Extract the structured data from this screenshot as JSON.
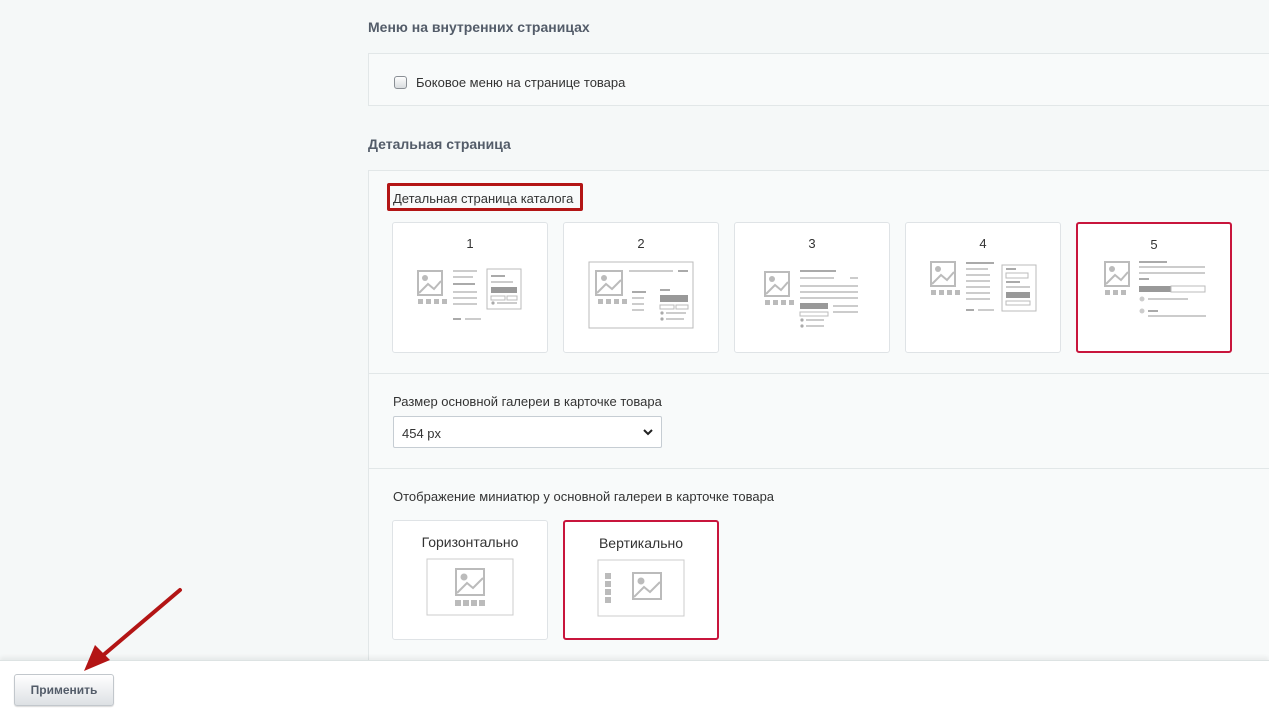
{
  "sections": {
    "inner_menu_title": "Меню на внутренних страницах",
    "detail_title": "Детальная страница"
  },
  "inner_menu": {
    "checkbox_label": "Боковое меню на странице товара",
    "checked": false
  },
  "detail_page": {
    "label": "Детальная страница каталога",
    "options": [
      "1",
      "2",
      "3",
      "4",
      "5"
    ],
    "selected": "5"
  },
  "gallery_size": {
    "label": "Размер основной галереи в карточке товара",
    "value": "454 px"
  },
  "thumbs": {
    "label": "Отображение миниатюр у основной галереи в карточке товара",
    "horizontal": "Горизонтально",
    "vertical": "Вертикально",
    "selected": "Вертикально"
  },
  "footer": {
    "apply_label": "Применить"
  },
  "colors": {
    "selected_border": "#c8153c",
    "highlight": "#b31515",
    "arrow": "#b31515"
  }
}
